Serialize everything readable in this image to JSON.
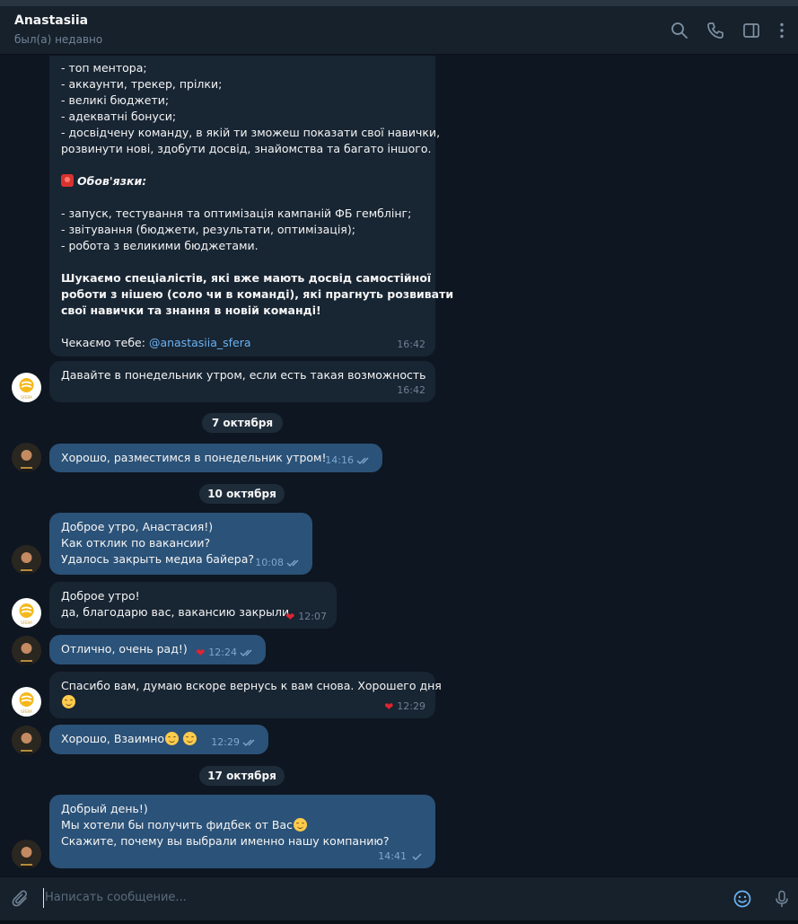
{
  "header": {
    "name": "Anastasiia",
    "status": "был(а) недавно"
  },
  "messages": [
    {
      "from": "contact",
      "lines": [
        "- топ ментора;",
        "- аккаунти, трекер, прілки;",
        "- великі бюджети;",
        "- адекватні бонуси;",
        "- досвідчену команду, в якій ти зможеш показати свої навички,",
        "розвинути нові, здобути досвід, знайомства та багато іншого.",
        "",
        "Обов'язки:",
        "",
        "- запуск, тестування та оптимізація кампаній ФБ гемблінг;",
        "- звітування (бюджети, результати, оптимізація);",
        "- робота з великими бюджетами.",
        "",
        "Шукаємо спеціалістів, які вже мають досвід самостійної",
        "роботи з нішею (соло чи в команді), які прагнуть розвивати",
        "свої навички та знання в новій команді!",
        "",
        "Чекаємо тебе: "
      ],
      "mention": "@anastasiia_sfera",
      "time": "16:42"
    },
    {
      "from": "contact",
      "text": "Давайте в понедельник утром, если есть такая возможность",
      "time": "16:42"
    },
    {
      "date": "7 октября"
    },
    {
      "from": "me",
      "text": "Хорошо, разместимся в понедельник утром!",
      "time": "14:16",
      "read": true
    },
    {
      "date": "10 октября"
    },
    {
      "from": "me",
      "lines": [
        "Доброе утро, Анастасия!)",
        "Как отклик по вакансии?",
        "Удалось закрыть медиа байера?"
      ],
      "time": "10:08",
      "read": true
    },
    {
      "from": "contact",
      "lines": [
        "Доброе утро!",
        "да, благодарю вас, вакансию закрыли"
      ],
      "time": "12:07",
      "reaction": "heart"
    },
    {
      "from": "me",
      "text": "Отлично, очень рад!)",
      "time": "12:24",
      "reaction": "heart",
      "read": true
    },
    {
      "from": "contact",
      "text": "Спасибо вам, думаю вскоре вернусь к вам снова. Хорошего дня",
      "time": "12:29",
      "reaction": "heart"
    },
    {
      "from": "me",
      "text": "Хорошо, Взаимно",
      "time": "12:29",
      "read": true
    },
    {
      "date": "17 октября"
    },
    {
      "from": "me",
      "lines": [
        "Добрый день!)",
        "Мы хотели бы получить фидбек от Вас",
        "Скажите, почему вы выбрали именно нашу компанию?"
      ],
      "time": "14:41",
      "read": false
    }
  ],
  "composer": {
    "placeholder": "Написать сообщение..."
  },
  "colors": {
    "background": "#0e1621",
    "incoming_bubble": "#182533",
    "outgoing_bubble": "#2b5278",
    "accent": "#6ab3f3",
    "reaction": "#e0242f"
  }
}
